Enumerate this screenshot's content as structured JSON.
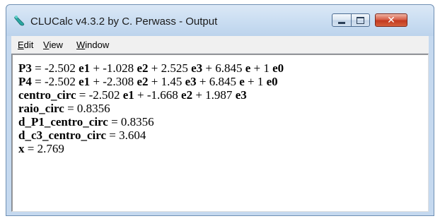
{
  "window": {
    "title": "CLUCalc v4.3.2 by C. Perwass - Output",
    "controls": {
      "minimize": "minimize",
      "maximize": "maximize",
      "close": "close"
    }
  },
  "menu": [
    {
      "accel": "E",
      "rest": "dit"
    },
    {
      "accel": "V",
      "rest": "iew"
    },
    {
      "accel": "W",
      "rest": "indow"
    }
  ],
  "output": {
    "lines": [
      {
        "segments": [
          {
            "t": "P3",
            "b": true
          },
          {
            "t": " = -2.502 ",
            "b": false
          },
          {
            "t": "e1",
            "b": true
          },
          {
            "t": " + -1.028 ",
            "b": false
          },
          {
            "t": "e2",
            "b": true
          },
          {
            "t": " + 2.525 ",
            "b": false
          },
          {
            "t": "e3",
            "b": true
          },
          {
            "t": " + 6.845 ",
            "b": false
          },
          {
            "t": "e",
            "b": true
          },
          {
            "t": " + 1 ",
            "b": false
          },
          {
            "t": "e0",
            "b": true
          }
        ]
      },
      {
        "segments": [
          {
            "t": "P4",
            "b": true
          },
          {
            "t": " = -2.502 ",
            "b": false
          },
          {
            "t": "e1",
            "b": true
          },
          {
            "t": " + -2.308 ",
            "b": false
          },
          {
            "t": "e2",
            "b": true
          },
          {
            "t": " + 1.45 ",
            "b": false
          },
          {
            "t": "e3",
            "b": true
          },
          {
            "t": " + 6.845 ",
            "b": false
          },
          {
            "t": "e",
            "b": true
          },
          {
            "t": " + 1 ",
            "b": false
          },
          {
            "t": "e0",
            "b": true
          }
        ]
      },
      {
        "segments": [
          {
            "t": "centro_circ",
            "b": true
          },
          {
            "t": " = -2.502 ",
            "b": false
          },
          {
            "t": "e1",
            "b": true
          },
          {
            "t": " + -1.668 ",
            "b": false
          },
          {
            "t": "e2",
            "b": true
          },
          {
            "t": " + 1.987 ",
            "b": false
          },
          {
            "t": "e3",
            "b": true
          }
        ]
      },
      {
        "segments": [
          {
            "t": "raio_circ",
            "b": true
          },
          {
            "t": " = 0.8356",
            "b": false
          }
        ]
      },
      {
        "segments": [
          {
            "t": "d_P1_centro_circ",
            "b": true
          },
          {
            "t": " = 0.8356",
            "b": false
          }
        ]
      },
      {
        "segments": [
          {
            "t": "d_c3_centro_circ",
            "b": true
          },
          {
            "t": " = 3.604",
            "b": false
          }
        ]
      },
      {
        "segments": [
          {
            "t": "x",
            "b": true
          },
          {
            "t": " = 2.769",
            "b": false
          }
        ]
      }
    ]
  },
  "colors": {
    "title_bar": "#c8dcf1",
    "close_button": "#c2391f",
    "content_bg": "#ffffff"
  }
}
